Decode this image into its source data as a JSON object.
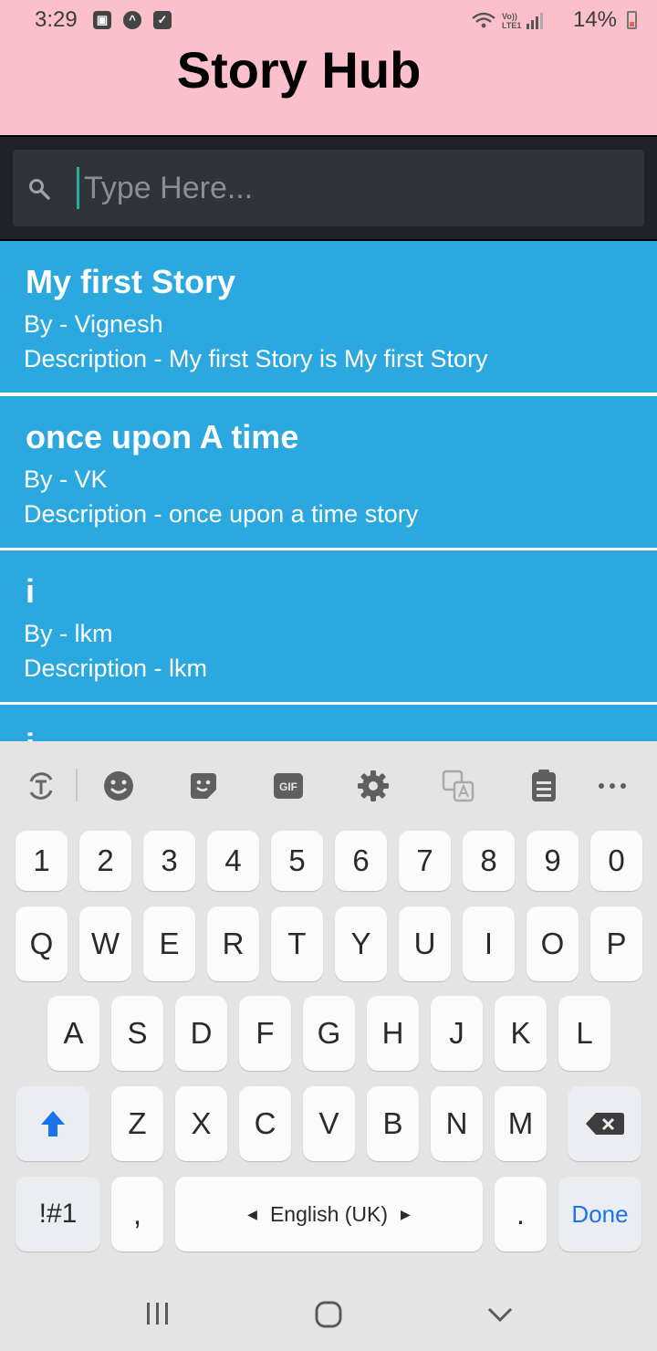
{
  "status": {
    "time": "3:29",
    "battery": "14%"
  },
  "app": {
    "title": "Story Hub"
  },
  "search": {
    "placeholder": "Type Here..."
  },
  "stories": [
    {
      "title": "My first Story",
      "author": "By - Vignesh",
      "description": "Description - My first Story is My first Story"
    },
    {
      "title": "once upon A time",
      "author": "By - VK",
      "description": "Description - once upon a time story"
    },
    {
      "title": "i",
      "author": "By - lkm",
      "description": "Description - lkm"
    },
    {
      "title": "i",
      "author": "",
      "description": ""
    }
  ],
  "keyboard": {
    "toolbar": [
      "text-recognition-icon",
      "emoji-icon",
      "sticker-icon",
      "gif-icon",
      "settings-icon",
      "translate-icon",
      "clipboard-icon",
      "more-icon"
    ],
    "gif_label": "GIF",
    "row_numbers": [
      "1",
      "2",
      "3",
      "4",
      "5",
      "6",
      "7",
      "8",
      "9",
      "0"
    ],
    "row_q": [
      "Q",
      "W",
      "E",
      "R",
      "T",
      "Y",
      "U",
      "I",
      "O",
      "P"
    ],
    "row_a": [
      "A",
      "S",
      "D",
      "F",
      "G",
      "H",
      "J",
      "K",
      "L"
    ],
    "row_z": [
      "Z",
      "X",
      "C",
      "V",
      "B",
      "N",
      "M"
    ],
    "symbols": "!#1",
    "comma": ",",
    "space": "English (UK)",
    "period": ".",
    "done": "Done"
  },
  "colors": {
    "header": "#fbc0cb",
    "card": "#2aa8df",
    "search_band": "#1f2227",
    "accent": "#1a73e8"
  }
}
